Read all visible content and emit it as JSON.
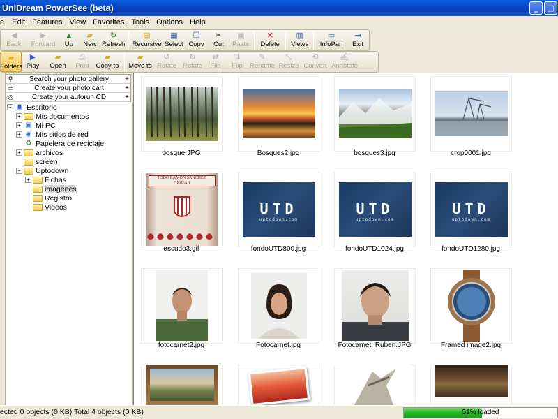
{
  "app": {
    "title": "UniDream PowerSee (beta)"
  },
  "menu": [
    "e",
    "Edit",
    "Features",
    "View",
    "Favorites",
    "Tools",
    "Options",
    "Help"
  ],
  "toolbar1": [
    {
      "label": "Back",
      "icon": "back-icon",
      "enabled": false
    },
    {
      "label": "Forward",
      "icon": "forward-icon",
      "enabled": false
    },
    {
      "label": "Up",
      "icon": "up-icon",
      "enabled": true
    },
    {
      "label": "New",
      "icon": "new-folder-icon",
      "enabled": true
    },
    {
      "label": "Refresh",
      "icon": "refresh-icon",
      "enabled": true
    },
    {
      "label": "Recursive",
      "icon": "recursive-icon",
      "enabled": true
    },
    {
      "label": "Select",
      "icon": "select-icon",
      "enabled": true
    },
    {
      "label": "Copy",
      "icon": "copy-icon",
      "enabled": true
    },
    {
      "label": "Cut",
      "icon": "scissors-icon",
      "enabled": true
    },
    {
      "label": "Paste",
      "icon": "paste-icon",
      "enabled": false
    },
    {
      "label": "Delete",
      "icon": "delete-icon",
      "enabled": true
    },
    {
      "label": "Views",
      "icon": "views-icon",
      "enabled": true
    },
    {
      "label": "InfoPan",
      "icon": "infopan-icon",
      "enabled": true
    },
    {
      "label": "Exit",
      "icon": "exit-icon",
      "enabled": true
    }
  ],
  "toolbar2": [
    {
      "label": "Folders",
      "icon": "folders-icon",
      "enabled": true,
      "pressed": true
    },
    {
      "label": "Play",
      "icon": "play-icon",
      "enabled": true
    },
    {
      "label": "Open",
      "icon": "open-icon",
      "enabled": true
    },
    {
      "label": "Print",
      "icon": "print-icon",
      "enabled": false
    },
    {
      "label": "Copy to",
      "icon": "copy-to-icon",
      "enabled": true
    },
    {
      "label": "Move to",
      "icon": "move-to-icon",
      "enabled": true
    },
    {
      "label": "Rotate",
      "icon": "rotate-left-icon",
      "enabled": false
    },
    {
      "label": "Rotate",
      "icon": "rotate-right-icon",
      "enabled": false
    },
    {
      "label": "Flip",
      "icon": "flip-horizontal-icon",
      "enabled": false
    },
    {
      "label": "Flip",
      "icon": "flip-vertical-icon",
      "enabled": false
    },
    {
      "label": "Rename",
      "icon": "rename-icon",
      "enabled": false
    },
    {
      "label": "Resize",
      "icon": "resize-icon",
      "enabled": false
    },
    {
      "label": "Convert",
      "icon": "convert-icon",
      "enabled": false
    },
    {
      "label": "Annotate",
      "icon": "annotate-icon",
      "enabled": false
    }
  ],
  "tasks": [
    "Search your photo gallery",
    "Create your photo cart",
    "Create your autorun CD"
  ],
  "tree": [
    {
      "label": "Escritorio",
      "icon": "desktop-icon",
      "level": 0,
      "expander": "−"
    },
    {
      "label": "Mis documentos",
      "icon": "folder-icon",
      "level": 1,
      "expander": "+"
    },
    {
      "label": "Mi PC",
      "icon": "computer-icon",
      "level": 1,
      "expander": "+"
    },
    {
      "label": "Mis sitios de red",
      "icon": "network-icon",
      "level": 1,
      "expander": "+"
    },
    {
      "label": "Papelera de reciclaje",
      "icon": "recycle-bin-icon",
      "level": 1,
      "expander": ""
    },
    {
      "label": "archivos",
      "icon": "folder-icon",
      "level": 1,
      "expander": "+"
    },
    {
      "label": "screen",
      "icon": "folder-icon",
      "level": 1,
      "expander": ""
    },
    {
      "label": "Uptodown",
      "icon": "folder-icon",
      "level": 1,
      "expander": "−"
    },
    {
      "label": "Fichas",
      "icon": "folder-icon",
      "level": 2,
      "expander": "+"
    },
    {
      "label": "imagenes",
      "icon": "folder-icon",
      "level": 2,
      "expander": "",
      "selected": true
    },
    {
      "label": "Registro",
      "icon": "folder-icon",
      "level": 2,
      "expander": ""
    },
    {
      "label": "Videos",
      "icon": "folder-icon",
      "level": 2,
      "expander": ""
    }
  ],
  "thumbnails": [
    {
      "name": "bosque.JPG",
      "kind": "forest"
    },
    {
      "name": "Bosques2.jpg",
      "kind": "sunset"
    },
    {
      "name": "bosques3.jpg",
      "kind": "mountain"
    },
    {
      "name": "crop0001.jpg",
      "kind": "crane"
    },
    {
      "name": "escudo3.gif",
      "kind": "banner"
    },
    {
      "name": "fondoUTD800.jpg",
      "kind": "utd"
    },
    {
      "name": "fondoUTD1024.jpg",
      "kind": "utd"
    },
    {
      "name": "fondoUTD1280.jpg",
      "kind": "utd"
    },
    {
      "name": "fotocarnet2.jpg",
      "kind": "portrait-green"
    },
    {
      "name": "Fotocarnet.jpg",
      "kind": "portrait-woman"
    },
    {
      "name": "Fotocarnet_Ruben.JPG",
      "kind": "portrait-dark"
    },
    {
      "name": "Framed image2.jpg",
      "kind": "watch"
    },
    {
      "name": "",
      "kind": "framed-landscape"
    },
    {
      "name": "",
      "kind": "tilted-photo"
    },
    {
      "name": "",
      "kind": "warrior"
    },
    {
      "name": "",
      "kind": "painting"
    }
  ],
  "utd_logo": {
    "text": "UTD",
    "sub": "uptodown.com"
  },
  "banner_text": "TODO RAMON SANCHEZ PIZJUAN",
  "status": {
    "text": "ected 0 objects (0 KB) Total 4 objects (0 KB)",
    "progress_text": "51% loaded",
    "progress": 0.51
  },
  "colors": {
    "title_bar": "#0A4FD6",
    "progress": "#1FB81F",
    "face": "#ECE9D8"
  }
}
